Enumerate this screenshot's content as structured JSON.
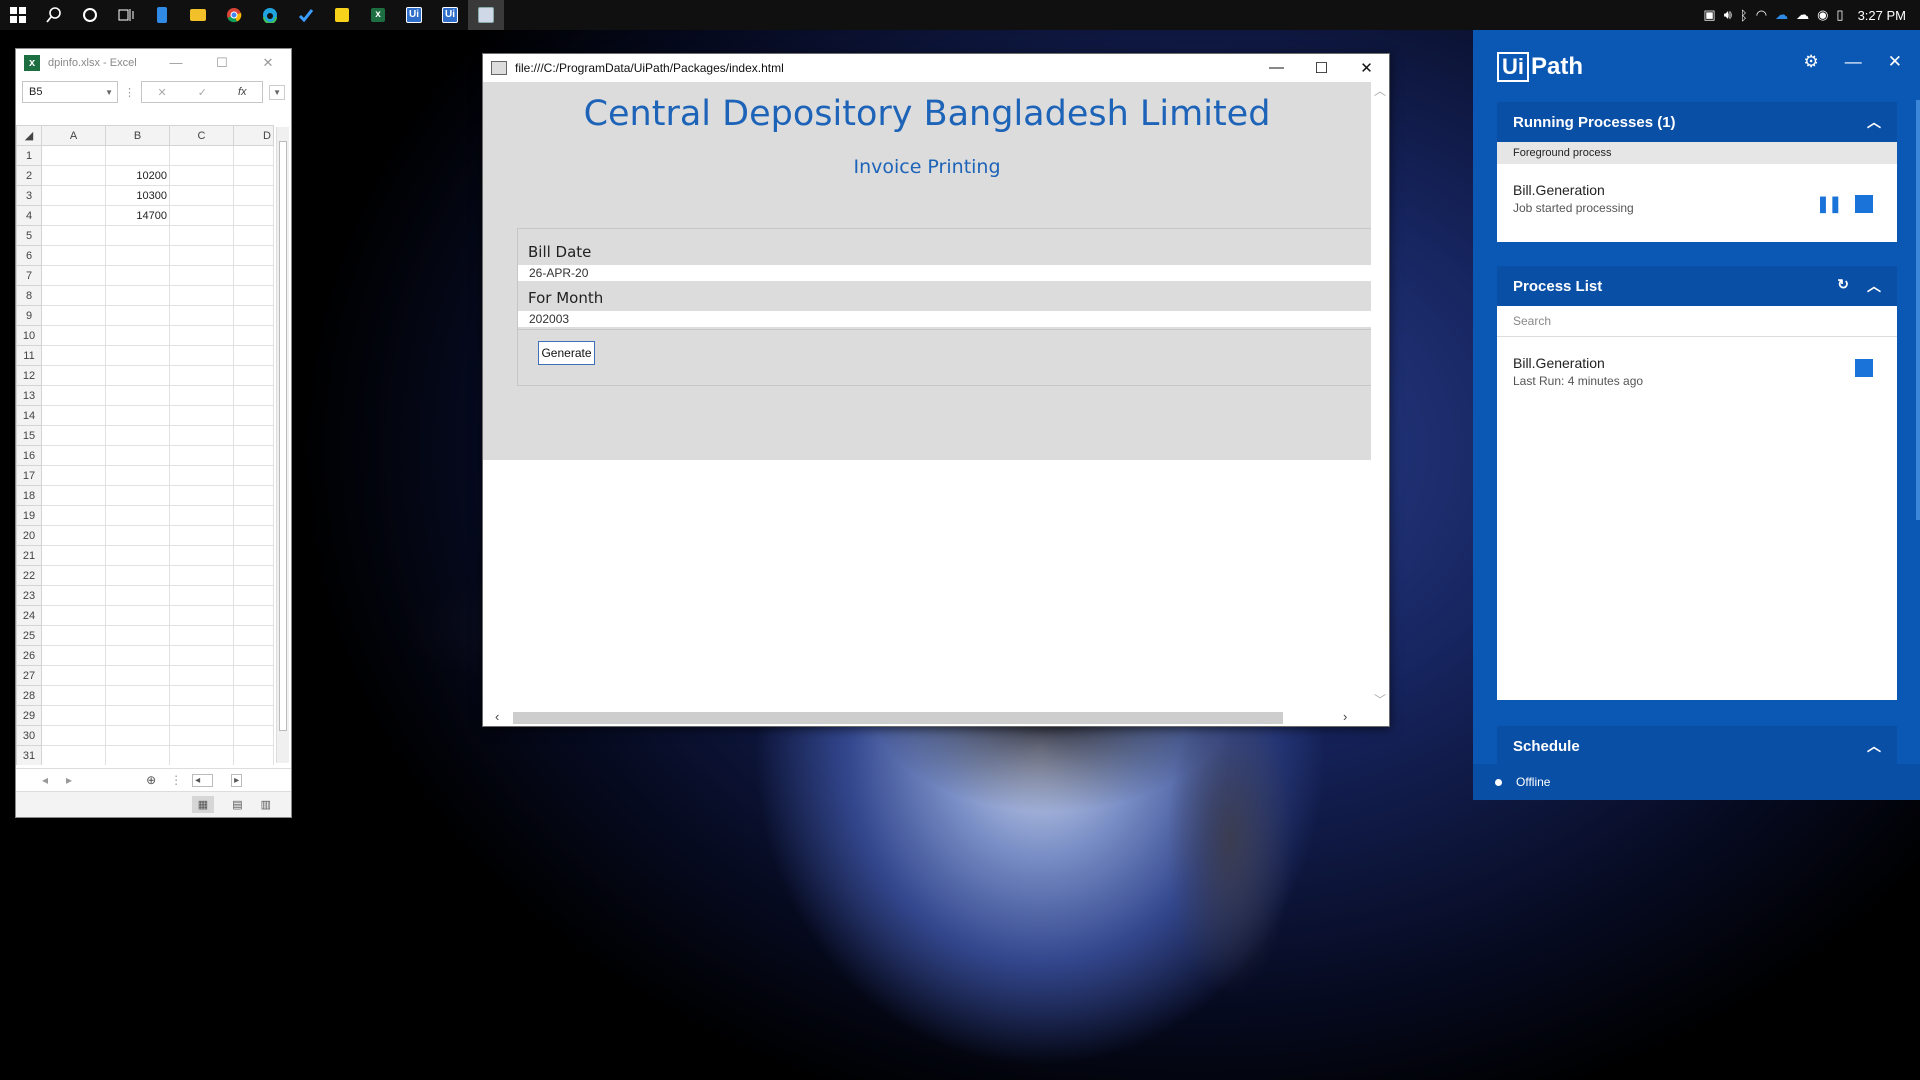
{
  "taskbar": {
    "icons": [
      "windows-start-icon",
      "search-icon",
      "cortana-icon",
      "task-view-icon",
      "notepad-icon",
      "file-explorer-icon",
      "chrome-icon",
      "edge-icon",
      "todo-icon",
      "sticky-notes-icon",
      "excel-icon",
      "uipath-studio-icon",
      "uipath-robot-icon",
      "browser-window-icon"
    ],
    "time": "3:27 PM"
  },
  "excel": {
    "title": "dpinfo.xlsx - Excel",
    "name_box": "B5",
    "fx_label": "fx",
    "columns": [
      "A",
      "B",
      "C",
      "D"
    ],
    "rows": [
      {
        "num": "1",
        "b": ""
      },
      {
        "num": "2",
        "b": "10200"
      },
      {
        "num": "3",
        "b": "10300"
      },
      {
        "num": "4",
        "b": "14700"
      },
      {
        "num": "5",
        "b": ""
      },
      {
        "num": "6",
        "b": ""
      },
      {
        "num": "7",
        "b": ""
      },
      {
        "num": "8",
        "b": ""
      },
      {
        "num": "9",
        "b": ""
      },
      {
        "num": "10",
        "b": ""
      },
      {
        "num": "11",
        "b": ""
      },
      {
        "num": "12",
        "b": ""
      },
      {
        "num": "13",
        "b": ""
      },
      {
        "num": "14",
        "b": ""
      },
      {
        "num": "15",
        "b": ""
      },
      {
        "num": "16",
        "b": ""
      },
      {
        "num": "17",
        "b": ""
      },
      {
        "num": "18",
        "b": ""
      },
      {
        "num": "19",
        "b": ""
      },
      {
        "num": "20",
        "b": ""
      },
      {
        "num": "21",
        "b": ""
      },
      {
        "num": "22",
        "b": ""
      },
      {
        "num": "23",
        "b": ""
      },
      {
        "num": "24",
        "b": ""
      },
      {
        "num": "25",
        "b": ""
      },
      {
        "num": "26",
        "b": ""
      },
      {
        "num": "27",
        "b": ""
      },
      {
        "num": "28",
        "b": ""
      },
      {
        "num": "29",
        "b": ""
      },
      {
        "num": "30",
        "b": ""
      },
      {
        "num": "31",
        "b": ""
      }
    ]
  },
  "browser": {
    "url": "file:///C:/ProgramData/UiPath/Packages/index.html",
    "heading": "Central Depository Bangladesh Limited",
    "subheading": "Invoice Printing",
    "bill_date_label": "Bill Date",
    "bill_date_value": "26-APR-20",
    "for_month_label": "For Month",
    "for_month_value": "202003",
    "generate_label": "Generate"
  },
  "uipath": {
    "logo_box": "Ui",
    "logo_text": "Path",
    "running": {
      "title": "Running Processes (1)",
      "sub": "Foreground process",
      "process_name": "Bill.Generation",
      "process_status": "Job started processing"
    },
    "process_list": {
      "title": "Process List",
      "search_placeholder": "Search",
      "process_name": "Bill.Generation",
      "process_status": "Last Run: 4 minutes ago"
    },
    "schedule": {
      "title": "Schedule"
    },
    "status": "Offline",
    "colors": {
      "panel_blue": "#0a57b4",
      "accent": "#1a73d9"
    }
  }
}
